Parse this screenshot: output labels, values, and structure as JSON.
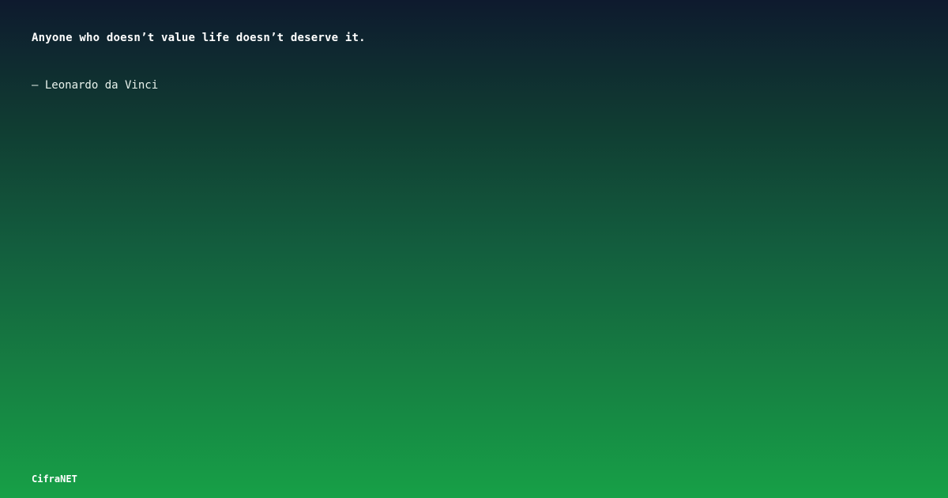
{
  "quote": {
    "text": "Anyone who doesn’t value life doesn’t deserve it.",
    "author": "– Leonardo da Vinci"
  },
  "brand": {
    "name": "CifraNET"
  },
  "colors": {
    "gradient_top": "#0e1a2e",
    "gradient_bottom": "#17a047",
    "text": "#ffffff"
  }
}
